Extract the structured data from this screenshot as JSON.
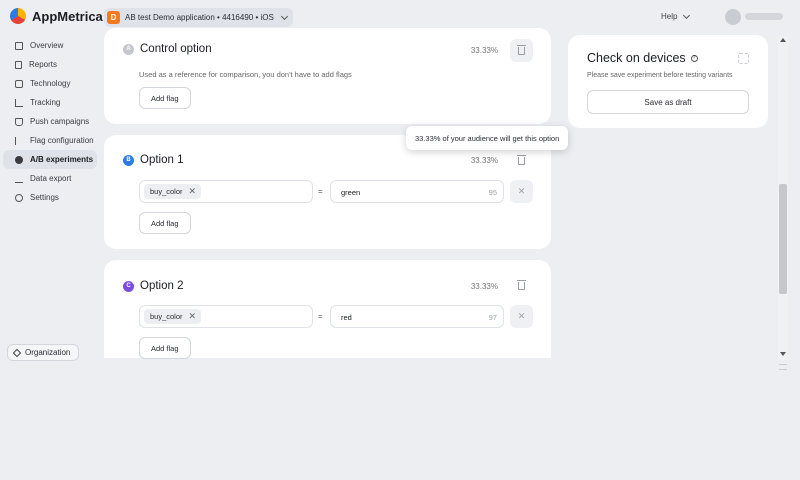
{
  "header": {
    "brand": "AppMetrica",
    "app_badge": "D",
    "app_label": "AB test Demo application  •  4416490  •  iOS",
    "help": "Help"
  },
  "sidebar": {
    "items": [
      {
        "label": "Overview",
        "icon": "grid-icon"
      },
      {
        "label": "Reports",
        "icon": "document-icon"
      },
      {
        "label": "Technology",
        "icon": "chip-icon"
      },
      {
        "label": "Tracking",
        "icon": "tracking-icon"
      },
      {
        "label": "Push campaigns",
        "icon": "push-icon"
      },
      {
        "label": "Flag configuration",
        "icon": "flag-icon"
      },
      {
        "label": "A/B experiments",
        "icon": "ab-icon",
        "active": true
      },
      {
        "label": "Data export",
        "icon": "export-icon"
      },
      {
        "label": "Settings",
        "icon": "gear-icon"
      }
    ],
    "organization": "Organization"
  },
  "options": [
    {
      "letter": "A",
      "letter_color": "#c4c7cd",
      "title": "Control option",
      "percent": "33.33%",
      "description": "Used as a reference for comparison, you don't have to add flags",
      "add_flag": "Add flag"
    },
    {
      "letter": "B",
      "letter_color": "#2d7be5",
      "title": "Option 1",
      "percent": "33.33%",
      "flag_name": "buy_color",
      "equals": "=",
      "flag_value": "green",
      "value_remaining": "95",
      "add_flag": "Add flag"
    },
    {
      "letter": "C",
      "letter_color": "#7c4ddb",
      "title": "Option 2",
      "percent": "33.33%",
      "flag_name": "buy_color",
      "equals": "=",
      "flag_value": "red",
      "value_remaining": "97",
      "add_flag": "Add flag"
    }
  ],
  "tooltip": "33.33% of your audience will get this option",
  "panel": {
    "title": "Check on devices",
    "subtitle": "Please save experiment before testing variants",
    "save_button": "Save as draft"
  }
}
